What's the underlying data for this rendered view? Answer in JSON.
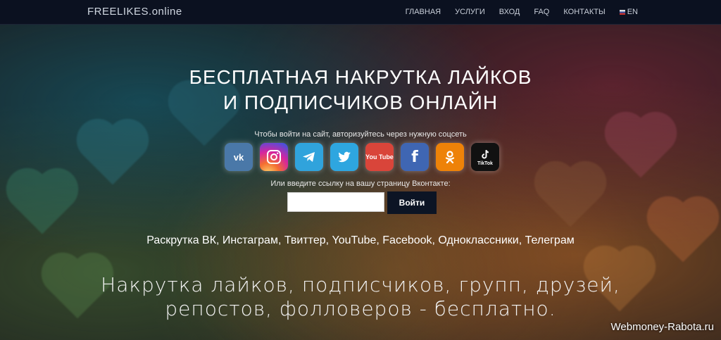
{
  "brand": "FREELIKES.online",
  "nav": [
    "ГЛАВНАЯ",
    "УСЛУГИ",
    "ВХОД",
    "FAQ",
    "КОНТАКТЫ"
  ],
  "lang": "EN",
  "hero": {
    "line1": "БЕСПЛАТНАЯ НАКРУТКА ЛАЙКОВ",
    "line2": "И ПОДПИСЧИКОВ ОНЛАЙН"
  },
  "auth_hint": "Чтобы войти на сайт, авторизуйтесь через нужную соцсеть",
  "socials": {
    "vk": "vk",
    "youtube_text": "You Tube",
    "tiktok_text": "TikTok"
  },
  "link_hint": "Или введите ссылку на вашу страницу Вконтакте:",
  "link_input": {
    "value": "",
    "placeholder": ""
  },
  "login_button": "Войти",
  "promo": "Раскрутка ВК, Инстаграм, Твиттер, YouTube, Facebook, Одноклассники, Телеграм",
  "tagline": {
    "line1": "Накрутка лайков, подписчиков, групп, друзей,",
    "line2": "репостов, фолловеров - бесплатно."
  },
  "watermark": "Webmoney-Rabota.ru",
  "colors": {
    "navbar": "#0b1120",
    "button": "#0c1424",
    "vk": "#4a78a8",
    "telegram": "#30a3dc",
    "twitter": "#2ea6e0",
    "youtube": "#d9453a",
    "facebook": "#3f66b3",
    "odnoklassniki": "#ee8208",
    "tiktok": "#111111"
  }
}
